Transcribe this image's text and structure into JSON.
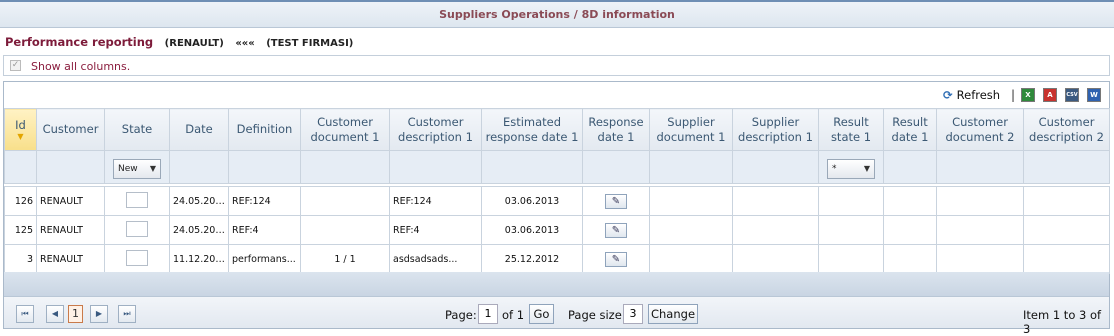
{
  "header": {
    "title": "Suppliers Operations / 8D information"
  },
  "report": {
    "title": "Performance reporting",
    "customer": "(RENAULT)",
    "arrows": "«««",
    "company": "(TEST FIRMASI)"
  },
  "show_columns": {
    "label": "Show all columns.",
    "checked": true,
    "check_glyph": "✓"
  },
  "toolbar": {
    "refresh_label": "Refresh",
    "refresh_glyph": "⟳",
    "separator": "|",
    "export_icons": [
      "excel-export-icon",
      "pdf-export-icon",
      "csv-export-icon",
      "word-export-icon"
    ],
    "export_glyphs": [
      "X",
      "A",
      "CSV",
      "W"
    ]
  },
  "grid": {
    "columns": [
      "Id",
      "Customer",
      "State",
      "Date",
      "Definition",
      "Customer document 1",
      "Customer description 1",
      "Estimated response date 1",
      "Response date 1",
      "Supplier document 1",
      "Supplier description 1",
      "Result state 1",
      "Result date 1",
      "Customer document 2",
      "Customer description 2"
    ],
    "sort_indicator": "▼",
    "filters": {
      "state": "New",
      "result_state": "*",
      "dropdown_glyph": "▼"
    },
    "rows": [
      {
        "id": "126",
        "customer": "RENAULT",
        "date": "24.05.2013",
        "definition": "REF:124",
        "customer_document_1": "",
        "customer_description_1": "REF:124",
        "estimated_response_date_1": "03.06.2013"
      },
      {
        "id": "125",
        "customer": "RENAULT",
        "date": "24.05.2013",
        "definition": "REF:4",
        "customer_document_1": "",
        "customer_description_1": "REF:4",
        "estimated_response_date_1": "03.06.2013"
      },
      {
        "id": "3",
        "customer": "RENAULT",
        "date": "11.12.2012",
        "definition": "performans...",
        "customer_document_1": "1 / 1",
        "customer_description_1": "asdsadsads...",
        "estimated_response_date_1": "25.12.2012"
      }
    ],
    "edit_glyph": "✎"
  },
  "pager": {
    "first_glyph": "⏮",
    "prev_glyph": "◀",
    "next_glyph": "▶",
    "last_glyph": "⏭",
    "current_page": "1",
    "page_label": "Page:",
    "page_value": "1",
    "of_label": "of 1",
    "go_label": "Go",
    "page_size_label": "Page size:",
    "page_size_value": "3",
    "change_label": "Change",
    "items_text": "Item 1 to 3 of 3"
  }
}
